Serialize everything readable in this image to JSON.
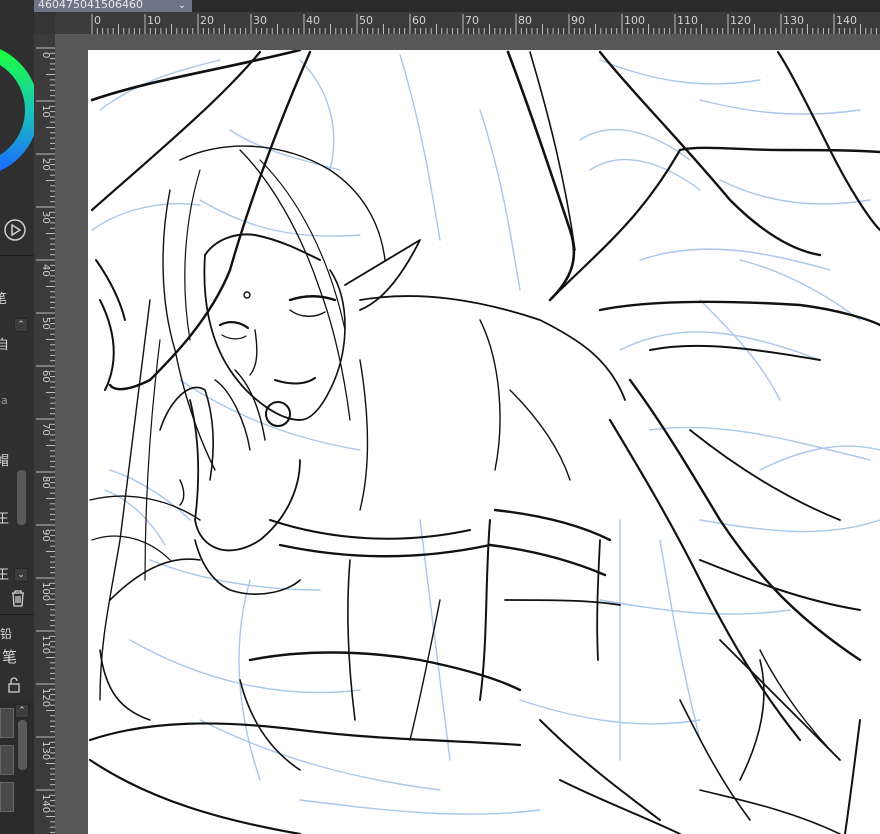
{
  "document_tab": {
    "title": "460475041506460",
    "close_symbol": "⌄"
  },
  "ruler": {
    "horizontal_labels": [
      "0",
      "10",
      "20",
      "30",
      "40",
      "50",
      "60",
      "70",
      "80",
      "90",
      "100",
      "110",
      "120",
      "130",
      "140"
    ],
    "vertical_labels": [
      "0",
      "10",
      "20",
      "30",
      "40",
      "50",
      "60",
      "70",
      "80",
      "90",
      "100",
      "110",
      "120",
      "130",
      "140"
    ]
  },
  "left_panel": {
    "partial_labels": [
      "笔",
      "自",
      "na",
      "帽",
      "王",
      "王",
      "线铅",
      "笔"
    ],
    "icons": [
      "color-wheel",
      "play-icon",
      "scroll-up",
      "scroll-down",
      "delete-icon",
      "lock-icon",
      "sub-tool-icon"
    ]
  },
  "colors": {
    "ui_dark": "#2f2f2f",
    "ruler": "#3b3b3b",
    "canvas": "#ffffff",
    "tab_active": "#6d7487",
    "sketch_blue": "#a9c6ec",
    "ink": "#111111"
  }
}
